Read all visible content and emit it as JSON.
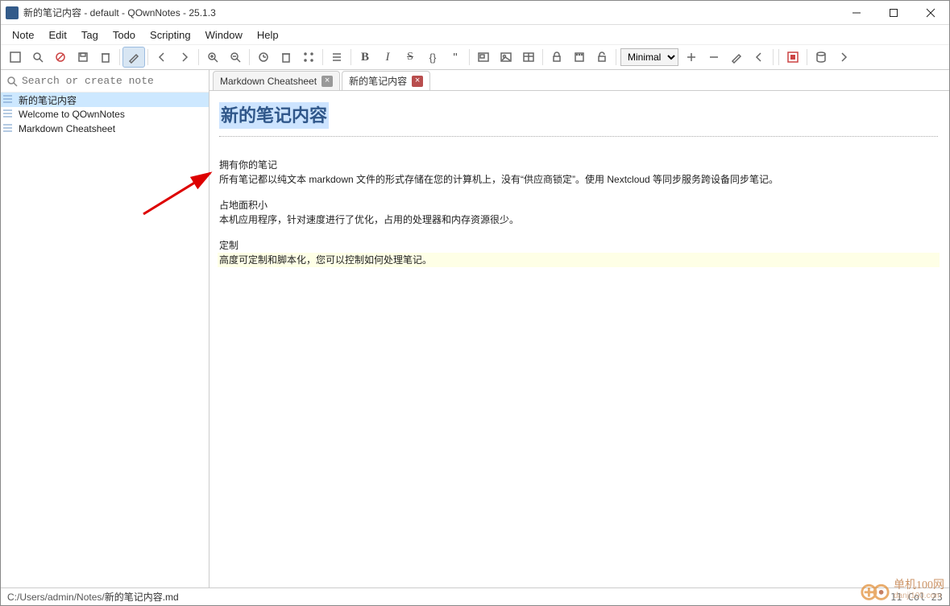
{
  "window": {
    "title": "新的笔记内容 - default - QOwnNotes - 25.1.3"
  },
  "menu": [
    "Note",
    "Edit",
    "Tag",
    "Todo",
    "Scripting",
    "Window",
    "Help"
  ],
  "search": {
    "placeholder": "Search or create note"
  },
  "notes": [
    {
      "label": "新的笔记内容",
      "selected": true
    },
    {
      "label": "Welcome to QOwnNotes",
      "selected": false
    },
    {
      "label": "Markdown Cheatsheet",
      "selected": false
    }
  ],
  "tabs": [
    {
      "label": "Markdown Cheatsheet",
      "active": false
    },
    {
      "label": "新的笔记内容",
      "active": true
    }
  ],
  "toolbar": {
    "workspace_selector": "Minimal"
  },
  "document": {
    "heading": "新的笔记内容",
    "p1a": "拥有你的笔记",
    "p1b": "所有笔记都以纯文本 markdown 文件的形式存储在您的计算机上，没有“供应商锁定”。使用 Nextcloud 等同步服务跨设备同步笔记。",
    "p2a": "占地面积小",
    "p2b": "本机应用程序，针对速度进行了优化，占用的处理器和内存资源很少。",
    "p3a": "定制",
    "p3b": "高度可定制和脚本化，您可以控制如何处理笔记。"
  },
  "statusbar": {
    "path_prefix": "C:/Users/admin/Notes/",
    "path_file": "新的笔记内容.md",
    "position": "11   Col 23"
  },
  "watermark": {
    "title": "单机100网",
    "sub": "danji100.com"
  }
}
